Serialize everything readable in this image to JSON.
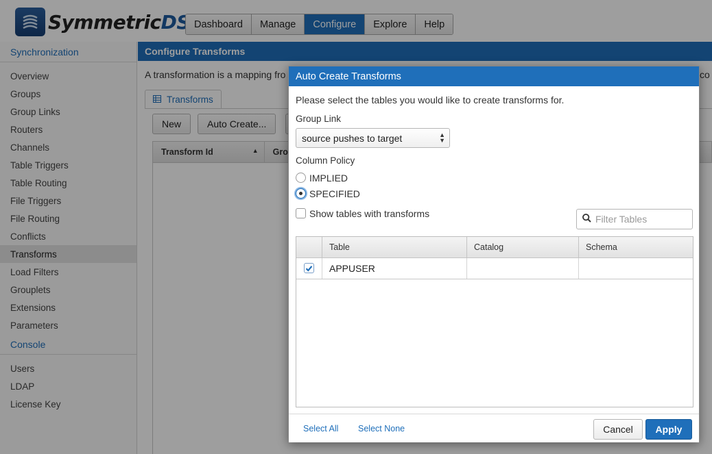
{
  "app": {
    "name_main": "Symmetric",
    "name_suffix": "DS"
  },
  "topnav": [
    {
      "label": "Dashboard",
      "active": false
    },
    {
      "label": "Manage",
      "active": false
    },
    {
      "label": "Configure",
      "active": true
    },
    {
      "label": "Explore",
      "active": false
    },
    {
      "label": "Help",
      "active": false
    }
  ],
  "sidebar": {
    "section_sync": "Synchronization",
    "sync_items": [
      "Overview",
      "Groups",
      "Group Links",
      "Routers",
      "Channels",
      "Table Triggers",
      "Table Routing",
      "File Triggers",
      "File Routing",
      "Conflicts",
      "Transforms",
      "Load Filters",
      "Grouplets",
      "Extensions",
      "Parameters"
    ],
    "active_item": "Transforms",
    "section_console": "Console",
    "console_items": [
      "Users",
      "LDAP",
      "License Key"
    ]
  },
  "main": {
    "title": "Configure Transforms",
    "description_left": "A transformation is a mapping fro",
    "description_right": "co",
    "tab_label": "Transforms",
    "new_button": "New",
    "auto_create_button": "Auto Create...",
    "grid_columns": [
      "Transform Id",
      "Grou"
    ]
  },
  "dialog": {
    "title": "Auto Create Transforms",
    "instruction": "Please select the tables you would like to create transforms for.",
    "group_link_label": "Group Link",
    "group_link_value": "source pushes to target",
    "column_policy_label": "Column Policy",
    "policy_implied": "IMPLIED",
    "policy_specified": "SPECIFIED",
    "selected_policy": "SPECIFIED",
    "show_tables_label": "Show tables with transforms",
    "show_tables_checked": false,
    "filter_placeholder": "Filter Tables",
    "table_columns": [
      "Table",
      "Catalog",
      "Schema"
    ],
    "rows": [
      {
        "checked": true,
        "table": "APPUSER",
        "catalog": "",
        "schema": ""
      }
    ],
    "select_all": "Select All",
    "select_none": "Select None",
    "cancel": "Cancel",
    "apply": "Apply"
  },
  "colors": {
    "accent": "#1f6fba",
    "overlay": "#000000"
  }
}
